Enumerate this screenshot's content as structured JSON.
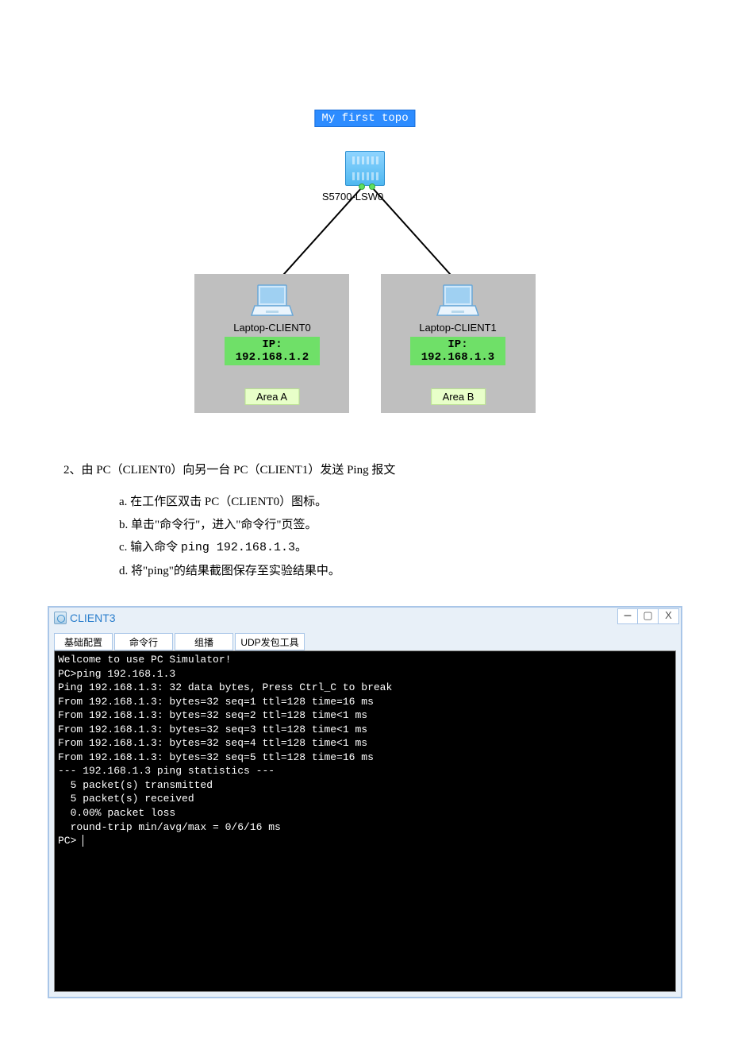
{
  "topology": {
    "title": "My first topo",
    "switch_label": "S5700-LSW0",
    "area_a_label": "Area A",
    "area_b_label": "Area B",
    "laptop_a_name": "Laptop-CLIENT0",
    "laptop_a_ip": "IP: 192.168.1.2",
    "laptop_b_name": "Laptop-CLIENT1",
    "laptop_b_ip": "IP: 192.168.1.3"
  },
  "instruction": "2、由 PC（CLIENT0）向另一台 PC（CLIENT1）发送 Ping 报文",
  "steps": {
    "a": "a. 在工作区双击 PC（CLIENT0）图标。",
    "b": "b. 单击\"命令行\"，进入\"命令行\"页签。",
    "c_pre": "c. 输入命令",
    "c_cmd": "ping 192.168.1.3",
    "c_post": "。",
    "d": "d. 将\"ping\"的结果截图保存至实验结果中。"
  },
  "client_window": {
    "title": "CLIENT3",
    "tabs": [
      "基础配置",
      "命令行",
      "组播",
      "UDP发包工具"
    ],
    "terminal_lines": [
      "Welcome to use PC Simulator!",
      "",
      "PC>ping 192.168.1.3",
      "",
      "Ping 192.168.1.3: 32 data bytes, Press Ctrl_C to break",
      "From 192.168.1.3: bytes=32 seq=1 ttl=128 time=16 ms",
      "From 192.168.1.3: bytes=32 seq=2 ttl=128 time<1 ms",
      "From 192.168.1.3: bytes=32 seq=3 ttl=128 time<1 ms",
      "From 192.168.1.3: bytes=32 seq=4 ttl=128 time<1 ms",
      "From 192.168.1.3: bytes=32 seq=5 ttl=128 time=16 ms",
      "",
      "--- 192.168.1.3 ping statistics ---",
      "  5 packet(s) transmitted",
      "  5 packet(s) received",
      "  0.00% packet loss",
      "  round-trip min/avg/max = 0/6/16 ms",
      "",
      "PC>"
    ]
  }
}
